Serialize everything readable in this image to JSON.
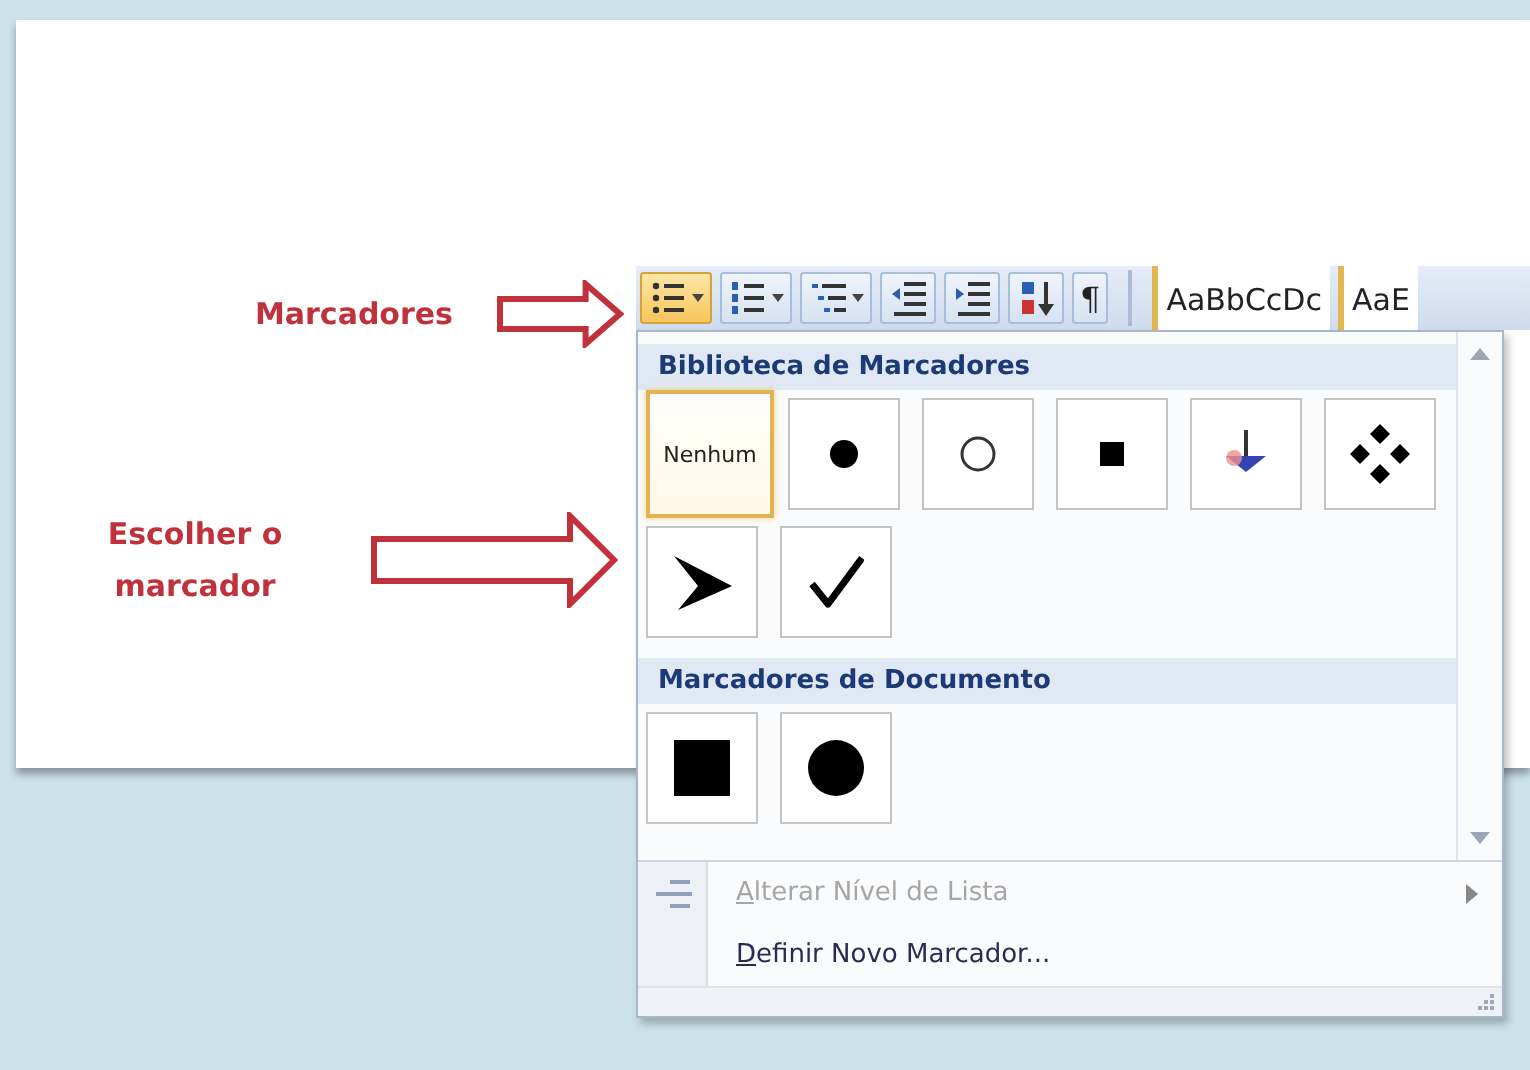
{
  "annotations": [
    {
      "kind": "short",
      "text": "Marcadores"
    },
    {
      "kind": "wrapped",
      "text": "Escolher o marcador"
    }
  ],
  "toolbar": {
    "buttons": [
      {
        "kind": "bullets",
        "selected": true
      },
      {
        "kind": "numbering",
        "selected": false
      },
      {
        "kind": "multilevel",
        "selected": false
      },
      {
        "kind": "decrease-indent",
        "selected": false
      },
      {
        "kind": "increase-indent",
        "selected": false
      },
      {
        "kind": "sort",
        "selected": false
      },
      {
        "kind": "pilcrow",
        "label": "¶",
        "selected": false
      }
    ],
    "styles": [
      "AaBbCcDc",
      "AaE"
    ]
  },
  "menu": {
    "sections": [
      {
        "title": "Biblioteca de Marcadores",
        "items": [
          {
            "kind": "none",
            "label": "Nenhum",
            "selected": true
          },
          {
            "kind": "dot",
            "selected": false
          },
          {
            "kind": "circle",
            "selected": false
          },
          {
            "kind": "square",
            "selected": false
          },
          {
            "kind": "pin",
            "selected": false
          },
          {
            "kind": "diamonds",
            "selected": false
          },
          {
            "kind": "arrowhead",
            "selected": false
          },
          {
            "kind": "check",
            "selected": false
          }
        ]
      },
      {
        "title": "Marcadores de Documento",
        "items": [
          {
            "kind": "big-square",
            "selected": false
          },
          {
            "kind": "big-dot",
            "selected": false
          }
        ]
      }
    ],
    "commands": [
      {
        "label": "Alterar Nível de Lista",
        "disabled": true,
        "submenu": true,
        "icon": true
      },
      {
        "label": "Definir Novo Marcador...",
        "disabled": false,
        "submenu": false,
        "icon": false
      }
    ]
  }
}
